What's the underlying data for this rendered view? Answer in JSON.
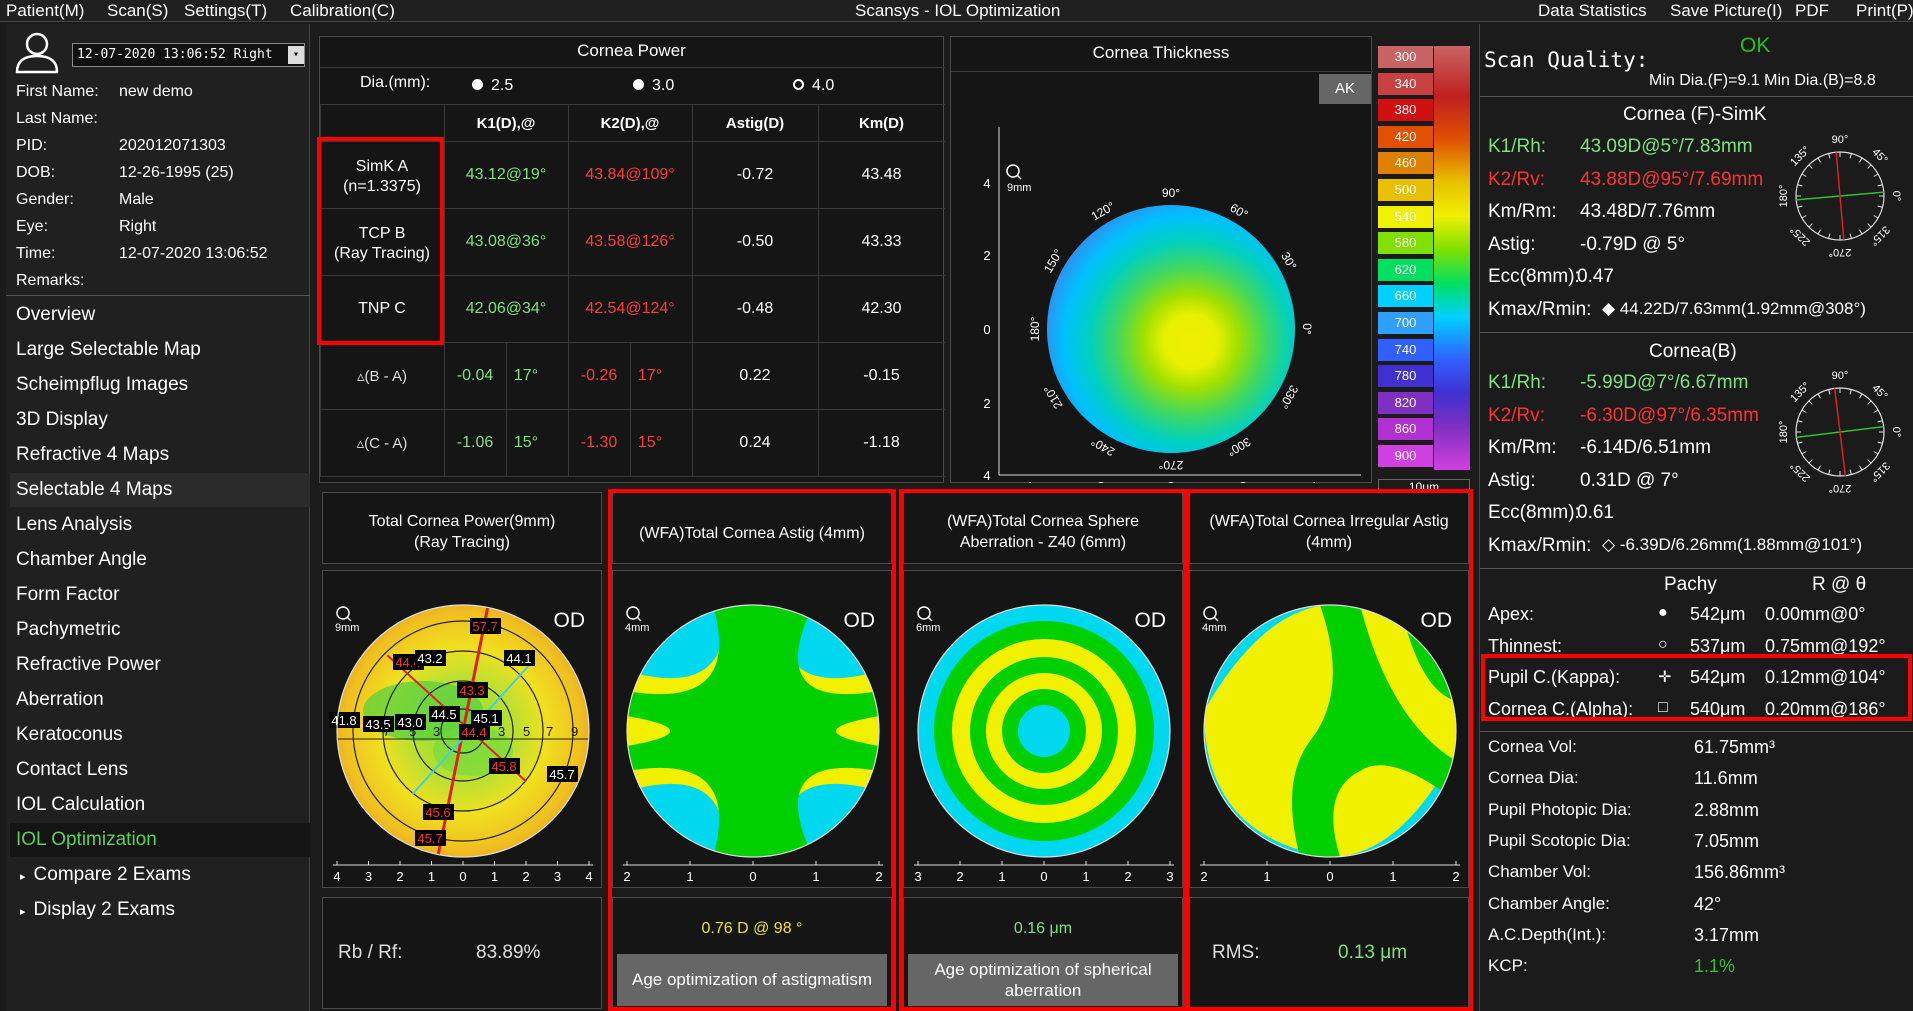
{
  "menubar": {
    "patient": "Patient(M)",
    "scan": "Scan(S)",
    "settings": "Settings(T)",
    "calibration": "Calibration(C)",
    "title": "Scansys - IOL Optimization",
    "data_statistics": "Data Statistics",
    "save_picture": "Save Picture(I)",
    "pdf": "PDF",
    "print": "Print(P)"
  },
  "patient": {
    "exam_select": "12-07-2020 13:06:52 Right",
    "rows": [
      {
        "label": "First Name:",
        "value": "new demo"
      },
      {
        "label": "Last Name:",
        "value": ""
      },
      {
        "label": "PID:",
        "value": "202012071303"
      },
      {
        "label": "DOB:",
        "value": "12-26-1995  (25)"
      },
      {
        "label": "Gender:",
        "value": "Male"
      },
      {
        "label": "Eye:",
        "value": "Right"
      },
      {
        "label": "Time:",
        "value": "12-07-2020 13:06:52"
      },
      {
        "label": "Remarks:",
        "value": ""
      }
    ]
  },
  "nav": [
    "Overview",
    "Large Selectable Map",
    "Scheimpflug Images",
    "3D Display",
    "Refractive 4 Maps",
    "Selectable 4 Maps",
    "Lens Analysis",
    "Chamber Angle",
    "Form Factor",
    "Pachymetric",
    "Refractive Power",
    "Aberration",
    "Keratoconus",
    "Contact Lens",
    "IOL Calculation",
    "IOL Optimization",
    "Compare 2 Exams",
    "Display 2 Exams"
  ],
  "cornea_power": {
    "title": "Cornea Power",
    "dia_label": "Dia.(mm):",
    "dia_options": [
      "2.5",
      "3.0",
      "4.0"
    ],
    "headers": [
      "K1(D),@",
      "K2(D),@",
      "Astig(D)",
      "Km(D)"
    ],
    "rows": [
      {
        "label": "SimK A",
        "label2": "(n=1.3375)",
        "k1": "43.12@19°",
        "k2": "43.84@109°",
        "astig": "-0.72",
        "km": "43.48"
      },
      {
        "label": "TCP B",
        "label2": "(Ray Tracing)",
        "k1": "43.08@36°",
        "k2": "43.58@126°",
        "astig": "-0.50",
        "km": "43.33"
      },
      {
        "label": "TNP C",
        "label2": "",
        "k1": "42.06@34°",
        "k2": "42.54@124°",
        "astig": "-0.48",
        "km": "42.30"
      }
    ],
    "diff_rows": [
      {
        "label": "▵(B - A)",
        "k1": "-0.04",
        "k1a": "17°",
        "k2": "-0.26",
        "k2a": "17°",
        "astig": "0.22",
        "km": "-0.15"
      },
      {
        "label": "▵(C - A)",
        "k1": "-1.06",
        "k1a": "15°",
        "k2": "-1.30",
        "k2a": "15°",
        "astig": "0.24",
        "km": "-1.18"
      }
    ]
  },
  "cornea_thickness": {
    "title": "Cornea Thickness",
    "ak_button": "AK",
    "zoom": "9mm",
    "angles": [
      "90°",
      "60°",
      "30°",
      "0°",
      "330°",
      "300°",
      "270°",
      "240°",
      "210°",
      "180°",
      "150°",
      "120°"
    ],
    "axis_ticks": [
      "4",
      "2",
      "0",
      "2",
      "4"
    ],
    "legend": [
      "300",
      "340",
      "380",
      "420",
      "460",
      "500",
      "540",
      "580",
      "620",
      "660",
      "700",
      "740",
      "780",
      "820",
      "860",
      "900"
    ],
    "legend_colors": [
      "#c86464",
      "#c84040",
      "#d01010",
      "#e05000",
      "#e08000",
      "#e8c000",
      "#f0f000",
      "#80e000",
      "#00e060",
      "#00d0ff",
      "#30a0ff",
      "#3060ff",
      "#4030d0",
      "#8030c0",
      "#b030d0",
      "#d040e0"
    ],
    "legend_step": "10μm",
    "legend_mode": "Abs"
  },
  "maps": [
    {
      "title": "Total Cornea Power(9mm)\n(Ray Tracing)",
      "zoom": "9mm",
      "od": "OD",
      "ticks": [
        "4",
        "3",
        "2",
        "1",
        "0",
        "1",
        "2",
        "3",
        "4"
      ],
      "labels": [
        "57.7",
        "44.4",
        "43.2",
        "44.1",
        "43.3",
        "41.8",
        "43.5",
        "43.0",
        "44.5",
        "45.1",
        "44.4",
        "45.8",
        "45.7",
        "45.6",
        "45.7"
      ],
      "ring_numbers": [
        "7",
        "5",
        "3",
        "3",
        "5",
        "7",
        "9"
      ]
    },
    {
      "title": "(WFA)Total Cornea Astig (4mm)",
      "zoom": "4mm",
      "od": "OD",
      "ticks": [
        "2",
        "1",
        "0",
        "1",
        "2"
      ]
    },
    {
      "title": "(WFA)Total Cornea Sphere\nAberration - Z40 (6mm)",
      "zoom": "6mm",
      "od": "OD",
      "ticks": [
        "3",
        "2",
        "1",
        "0",
        "1",
        "2",
        "3"
      ]
    },
    {
      "title": "(WFA)Total Cornea Irregular Astig\n(4mm)",
      "zoom": "4mm",
      "od": "OD",
      "ticks": [
        "2",
        "1",
        "0",
        "1",
        "2"
      ]
    }
  ],
  "bottom": {
    "rb_rf_label": "Rb / Rf:",
    "rb_rf_value": "83.89%",
    "astig_value": "0.76 D @ 98 °",
    "astig_button": "Age optimization of astigmatism",
    "sphere_value": "0.16 μm",
    "sphere_button": "Age optimization of spherical aberration",
    "rms_label": "RMS:",
    "rms_value": "0.13 μm"
  },
  "right": {
    "scan_quality_label": "Scan Quality:",
    "scan_quality_value": "OK",
    "min_dia": "Min Dia.(F)=9.1  Min Dia.(B)=8.8",
    "front_title": "Cornea (F)-SimK",
    "front": [
      {
        "label": "K1/Rh:",
        "value": "43.09D@5°/7.83mm",
        "color": "green"
      },
      {
        "label": "K2/Rv:",
        "value": "43.88D@95°/7.69mm",
        "color": "red"
      },
      {
        "label": "Km/Rm:",
        "value": "43.48D/7.76mm",
        "color": "white"
      },
      {
        "label": "Astig:",
        "value": "-0.79D @ 5°",
        "color": "white"
      },
      {
        "label": "Ecc(8mm):",
        "value": "0.47",
        "color": "white"
      },
      {
        "label": "Kmax/Rmin:",
        "value": "◆ 44.22D/7.63mm(1.92mm@308°)",
        "color": "white"
      }
    ],
    "back_title": "Cornea(B)",
    "back": [
      {
        "label": "K1/Rh:",
        "value": "-5.99D@7°/6.67mm",
        "color": "green"
      },
      {
        "label": "K2/Rv:",
        "value": "-6.30D@97°/6.35mm",
        "color": "red"
      },
      {
        "label": "Km/Rm:",
        "value": "-6.14D/6.51mm",
        "color": "white"
      },
      {
        "label": "Astig:",
        "value": "0.31D @ 7°",
        "color": "white"
      },
      {
        "label": "Ecc(8mm):",
        "value": "0.61",
        "color": "white"
      },
      {
        "label": "Kmax/Rmin:",
        "value": "◇ -6.39D/6.26mm(1.88mm@101°)",
        "color": "white"
      }
    ],
    "dial_labels": [
      "90°",
      "45°",
      "0°",
      "315°",
      "270°",
      "225°",
      "180°",
      "135°"
    ],
    "pachy_header": "Pachy",
    "rtheta_header": "R @ θ",
    "pachy": [
      {
        "label": "Apex:",
        "symbol": "●",
        "pachy": "542μm",
        "rt": "0.00mm@0°"
      },
      {
        "label": "Thinnest:",
        "symbol": "○",
        "pachy": "537μm",
        "rt": "0.75mm@192°"
      },
      {
        "label": "Pupil C.(Kappa):",
        "symbol": "✛",
        "pachy": "542μm",
        "rt": "0.12mm@104°"
      },
      {
        "label": "Cornea C.(Alpha):",
        "symbol": "□",
        "pachy": "540μm",
        "rt": "0.20mm@186°"
      }
    ],
    "stats": [
      {
        "label": "Cornea Vol:",
        "value": "61.75mm³"
      },
      {
        "label": "Cornea Dia:",
        "value": "11.6mm"
      },
      {
        "label": "Pupil Photopic Dia:",
        "value": "2.88mm"
      },
      {
        "label": "Pupil Scotopic Dia:",
        "value": "7.05mm"
      },
      {
        "label": "Chamber Vol:",
        "value": "156.86mm³"
      },
      {
        "label": "Chamber Angle:",
        "value": "42°"
      },
      {
        "label": "A.C.Depth(Int.):",
        "value": "3.17mm"
      },
      {
        "label": "KCP:",
        "value": "1.1%"
      }
    ]
  }
}
